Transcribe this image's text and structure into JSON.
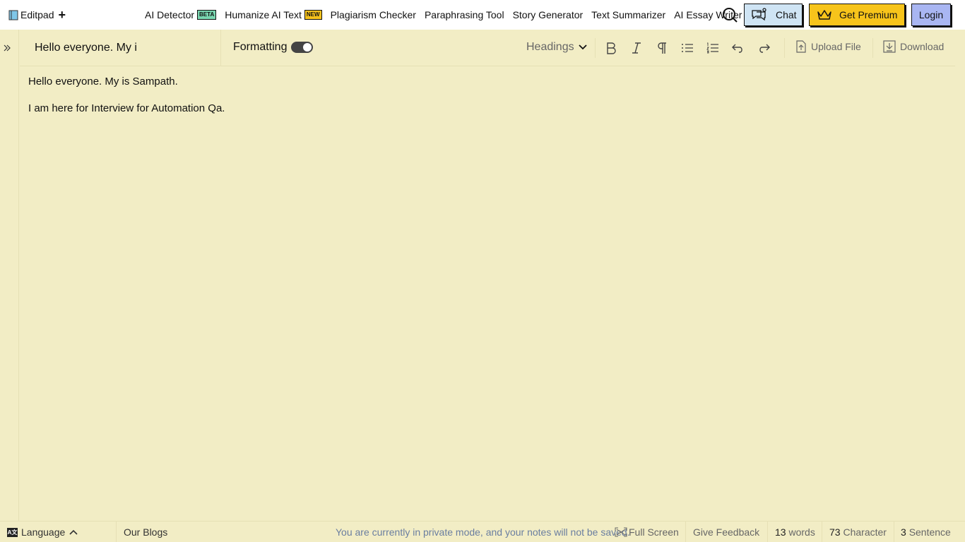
{
  "app": {
    "logo_text": "Editpad",
    "new_icon": "plus-icon"
  },
  "nav": {
    "items": [
      {
        "label": "AI Detector",
        "badge": "BETA"
      },
      {
        "label": "Humanize AI Text",
        "badge": "NEW"
      },
      {
        "label": "Plagiarism Checker",
        "badge": ""
      },
      {
        "label": "Paraphrasing Tool",
        "badge": ""
      },
      {
        "label": "Story Generator",
        "badge": ""
      },
      {
        "label": "Text Summarizer",
        "badge": ""
      },
      {
        "label": "AI Essay Writer",
        "badge": ""
      }
    ],
    "chat_label": "Chat",
    "premium_label": "Get Premium",
    "login_label": "Login"
  },
  "toolbar": {
    "title_value": "Hello everyone. My i",
    "formatting_label": "Formatting",
    "formatting_on": true,
    "headings_label": "Headings",
    "upload_label": "Upload File",
    "download_label": "Download"
  },
  "editor": {
    "paragraphs": [
      "Hello everyone. My is Sampath.",
      "I am here for Interview for Automation Qa."
    ]
  },
  "footer": {
    "language_label": "Language",
    "blogs_label": "Our Blogs",
    "private_message": "You are currently in private mode, and your notes will not be saved.",
    "fullscreen_label": "Full Screen",
    "feedback_label": "Give Feedback",
    "words_count": "13",
    "words_label": "words",
    "chars_count": "73",
    "chars_label": "Character",
    "sentences_count": "3",
    "sentences_label": "Sentence"
  },
  "colors": {
    "page_bg": "#f2edc5",
    "chat_bg": "#cfe4f4",
    "premium_bg": "#f7c41b",
    "login_bg": "#a9b6f2",
    "beta_badge": "#79d6b0",
    "new_badge": "#f6c21c"
  }
}
